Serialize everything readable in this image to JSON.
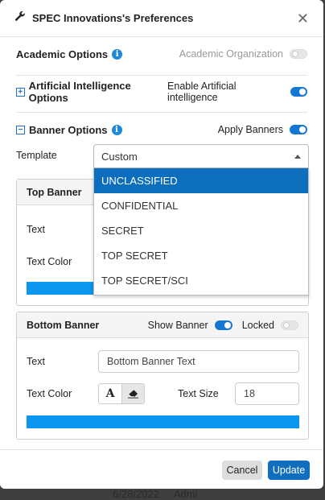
{
  "dialog": {
    "title": "SPEC Innovations's Preferences"
  },
  "academic": {
    "label": "Academic Options",
    "toggle_label": "Academic Organization",
    "enabled": false
  },
  "ai": {
    "label": "Artificial Intelligence Options",
    "toggle_label": "Enable Artificial intelligence",
    "enabled": true
  },
  "banner": {
    "label": "Banner Options",
    "toggle_label": "Apply Banners",
    "enabled": true,
    "template_label": "Template",
    "template_value": "Custom",
    "template_options": [
      "UNCLASSIFIED",
      "CONFIDENTIAL",
      "SECRET",
      "TOP SECRET",
      "TOP SECRET/SCI"
    ],
    "selected_option": "UNCLASSIFIED"
  },
  "top_banner": {
    "title": "Top Banner",
    "text_label": "Text",
    "color_label": "Text Color",
    "color": "#0b96ef"
  },
  "bottom_banner": {
    "title": "Bottom Banner",
    "show_label": "Show Banner",
    "show_enabled": true,
    "locked_label": "Locked",
    "locked_enabled": false,
    "text_label": "Text",
    "text_placeholder": "Bottom Banner Text",
    "color_label": "Text Color",
    "size_label": "Text Size",
    "size_value": "18",
    "color": "#0b96ef"
  },
  "footer": {
    "cancel_label": "Cancel",
    "update_label": "Update"
  },
  "background": {
    "date": "6/28/2022",
    "user": "Admi"
  },
  "colors": {
    "accent": "#1478d3",
    "selected_option": "#0d6ebe",
    "update_button": "#0f6ec0"
  }
}
